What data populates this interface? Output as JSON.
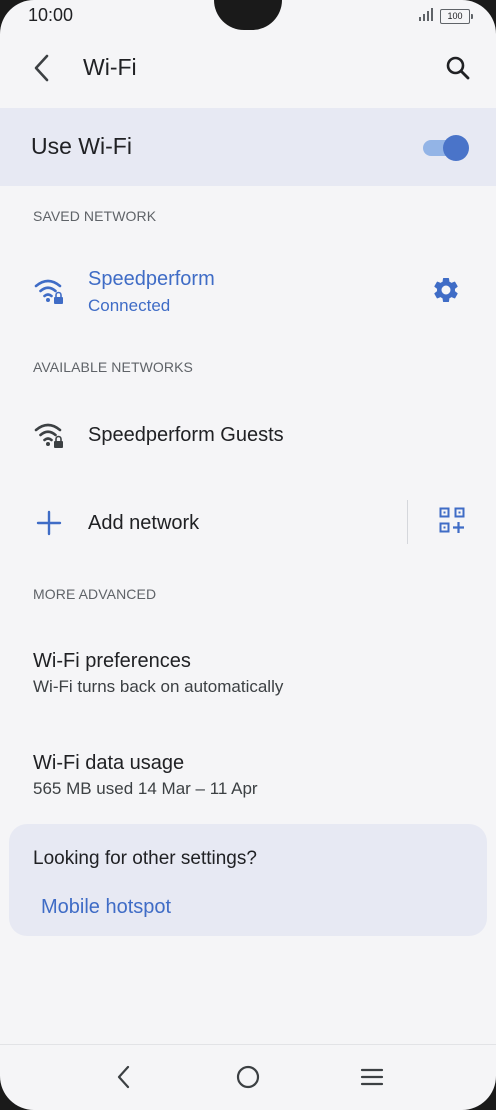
{
  "status_bar": {
    "time": "10:00",
    "battery": "100"
  },
  "app_bar": {
    "title": "Wi-Fi"
  },
  "master_switch": {
    "label": "Use Wi-Fi",
    "on": true
  },
  "saved_section": {
    "header": "SAVED NETWORK",
    "network": {
      "name": "Speedperform",
      "status": "Connected"
    }
  },
  "available_section": {
    "header": "AVAILABLE NETWORKS",
    "networks": [
      {
        "name": "Speedperform Guests"
      }
    ],
    "add_network_label": "Add network"
  },
  "advanced_section": {
    "header": "MORE ADVANCED",
    "items": [
      {
        "title": "Wi-Fi preferences",
        "subtitle": "Wi-Fi turns back on automatically"
      },
      {
        "title": "Wi-Fi data usage",
        "subtitle": "565 MB used 14 Mar – 11 Apr"
      }
    ]
  },
  "other_settings_card": {
    "title": "Looking for other settings?",
    "link": "Mobile hotspot"
  },
  "colors": {
    "accent": "#3f6cc6",
    "highlight_bg": "#e7e9f3",
    "background": "#f5f5f7"
  }
}
